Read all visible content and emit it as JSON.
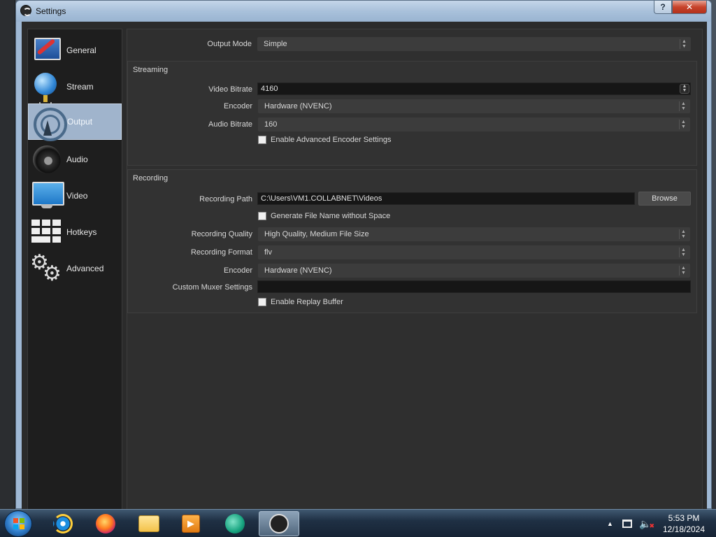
{
  "window": {
    "title": "Settings",
    "help_label": "?",
    "close_label": "✕"
  },
  "sidebar": {
    "items": [
      {
        "label": "General",
        "icon": "general-icon"
      },
      {
        "label": "Stream",
        "icon": "stream-globe-icon"
      },
      {
        "label": "Output",
        "icon": "output-broadcast-icon",
        "active": true
      },
      {
        "label": "Audio",
        "icon": "audio-speaker-icon"
      },
      {
        "label": "Video",
        "icon": "video-monitor-icon"
      },
      {
        "label": "Hotkeys",
        "icon": "hotkeys-keyboard-icon"
      },
      {
        "label": "Advanced",
        "icon": "advanced-gears-icon"
      }
    ]
  },
  "output": {
    "mode_label": "Output Mode",
    "mode_value": "Simple",
    "streaming": {
      "title": "Streaming",
      "video_bitrate_label": "Video Bitrate",
      "video_bitrate_value": "4160",
      "encoder_label": "Encoder",
      "encoder_value": "Hardware (NVENC)",
      "audio_bitrate_label": "Audio Bitrate",
      "audio_bitrate_value": "160",
      "advanced_encoder_label": "Enable Advanced Encoder Settings"
    },
    "recording": {
      "title": "Recording",
      "path_label": "Recording Path",
      "path_value": "C:\\Users\\VM1.COLLABNET\\Videos",
      "browse_label": "Browse",
      "no_space_label": "Generate File Name without Space",
      "quality_label": "Recording Quality",
      "quality_value": "High Quality, Medium File Size",
      "format_label": "Recording Format",
      "format_value": "flv",
      "encoder_label": "Encoder",
      "encoder_value": "Hardware (NVENC)",
      "muxer_label": "Custom Muxer Settings",
      "muxer_value": "",
      "replay_label": "Enable Replay Buffer"
    }
  },
  "taskbar": {
    "time": "5:53 PM",
    "date": "12/18/2024",
    "tray_arrow": "▲",
    "volume_glyph": "🔈",
    "volume_mute": "✖"
  },
  "colors": {
    "sidebar_active": "#a0b4cc",
    "panel_bg": "#2f2f2f",
    "field_bg": "#161616"
  }
}
